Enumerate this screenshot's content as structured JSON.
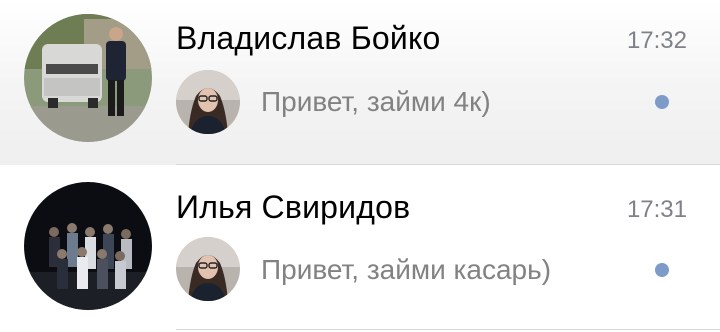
{
  "conversations": [
    {
      "name": "Владислав Бойко",
      "time": "17:32",
      "last_message": "Привет, займи 4к)",
      "unread": true,
      "avatar_icon": "contact-avatar-icon",
      "sender_avatar_icon": "sender-avatar-icon"
    },
    {
      "name": "Илья Свиридов",
      "time": "17:31",
      "last_message": "Привет, займи касарь)",
      "unread": true,
      "avatar_icon": "contact-avatar-icon",
      "sender_avatar_icon": "sender-avatar-icon"
    }
  ],
  "colors": {
    "unread_dot": "#7c9bc9",
    "name_text": "#000000",
    "message_text": "#828282",
    "time_text": "#7e8287",
    "divider": "#d9d9d9"
  }
}
